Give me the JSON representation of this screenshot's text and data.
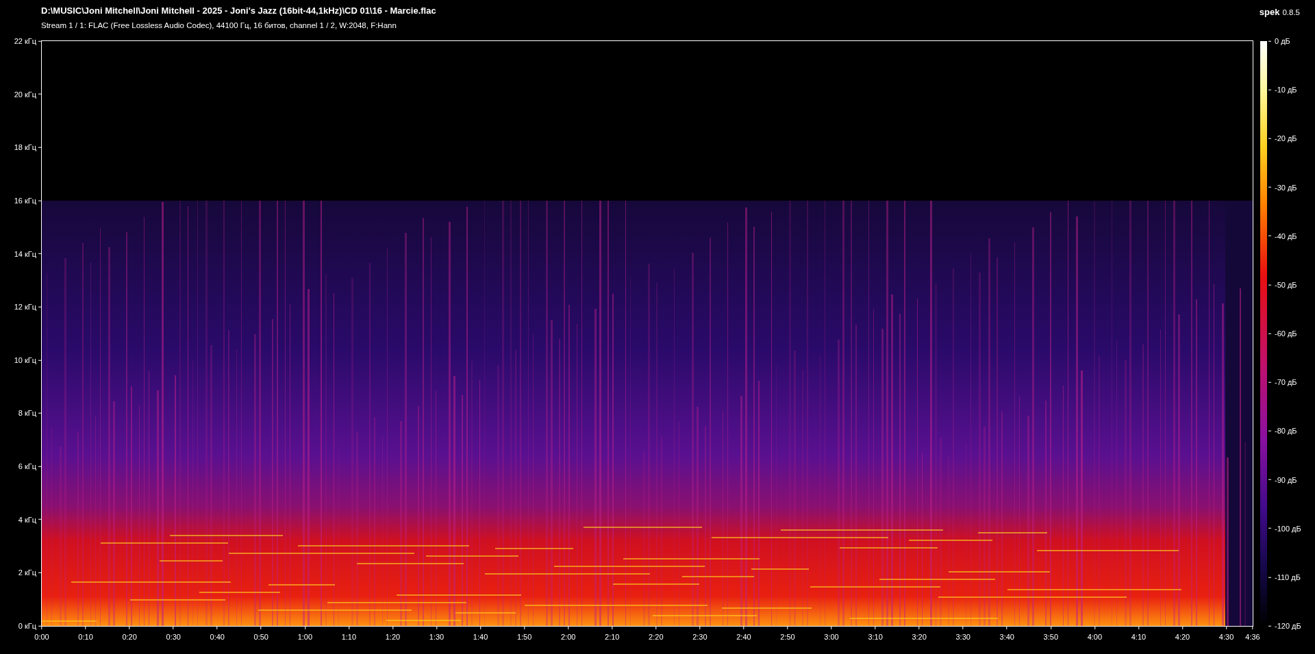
{
  "window": {
    "title": "D:\\MUSIC\\Joni Mitchell\\Joni Mitchell - 2025 - Joni's Jazz (16bit-44,1kHz)\\CD 01\\16 - Marcie.flac",
    "app_name": "spek",
    "app_version": "0.8.5"
  },
  "stream_info": "Stream 1 / 1: FLAC (Free Lossless Audio Codec), 44100 Гц, 16 битов, channel 1 / 2, W:2048, F:Hann",
  "frequency_axis": {
    "ticks": [
      "22 кГц",
      "20 кГц",
      "18 кГц",
      "16 кГц",
      "14 кГц",
      "12 кГц",
      "10 кГц",
      "8 кГц",
      "6 кГц",
      "4 кГц",
      "2 кГц",
      "0 кГц"
    ]
  },
  "time_axis": {
    "ticks": [
      "0:00",
      "0:10",
      "0:20",
      "0:30",
      "0:40",
      "0:50",
      "1:00",
      "1:10",
      "1:20",
      "1:30",
      "1:40",
      "1:50",
      "2:00",
      "2:10",
      "2:20",
      "2:30",
      "2:40",
      "2:50",
      "3:00",
      "3:10",
      "3:20",
      "3:30",
      "3:40",
      "3:50",
      "4:00",
      "4:10",
      "4:20",
      "4:30"
    ],
    "end": "4:36"
  },
  "level_scale": {
    "ticks": [
      "0 дБ",
      "-10 дБ",
      "-20 дБ",
      "-30 дБ",
      "-40 дБ",
      "-50 дБ",
      "-60 дБ",
      "-70 дБ",
      "-80 дБ",
      "-90 дБ",
      "-100 дБ",
      "-110 дБ",
      "-120 дБ"
    ]
  }
}
